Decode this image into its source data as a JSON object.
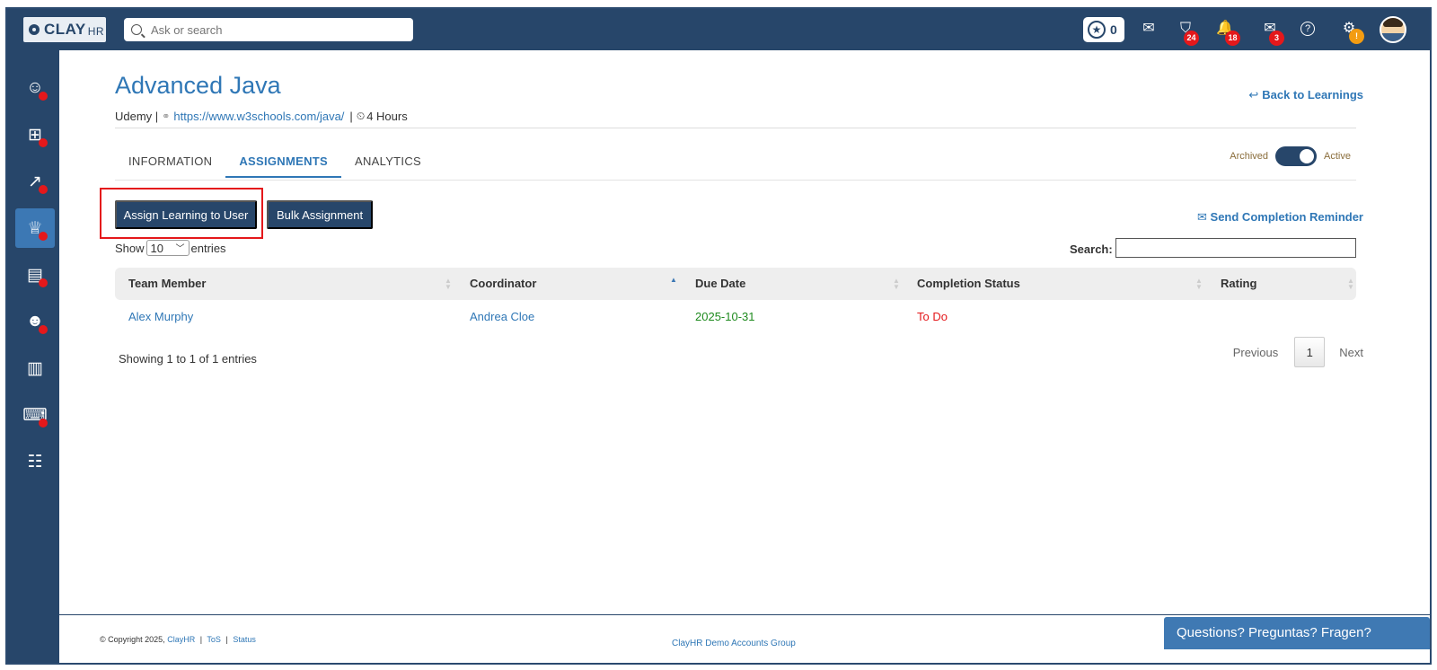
{
  "header": {
    "logo_text": "CLAY",
    "logo_suffix": "HR",
    "search_placeholder": "Ask or search",
    "star_count": "0",
    "icons": [
      {
        "name": "message-icon",
        "glyph": "✉"
      },
      {
        "name": "learning-icon",
        "glyph": "⛉",
        "badge": "24"
      },
      {
        "name": "bell-icon",
        "glyph": "🔔",
        "badge": "18"
      },
      {
        "name": "mail-icon",
        "glyph": "✉",
        "badge": "3"
      },
      {
        "name": "help-icon",
        "glyph": "?"
      },
      {
        "name": "settings-icon",
        "glyph": "⚙",
        "badge": "!"
      }
    ]
  },
  "sidebar": {
    "items": [
      {
        "name": "sidebar-item-people",
        "icon": "people-icon",
        "glyph": "☺"
      },
      {
        "name": "sidebar-item-payroll",
        "icon": "payroll-icon",
        "glyph": "⊞"
      },
      {
        "name": "sidebar-item-performance",
        "icon": "chart-up-icon",
        "glyph": "↗"
      },
      {
        "name": "sidebar-item-learning",
        "icon": "learning-icon",
        "glyph": "♕",
        "active": true
      },
      {
        "name": "sidebar-item-documents",
        "icon": "document-icon",
        "glyph": "▤"
      },
      {
        "name": "sidebar-item-recruiting",
        "icon": "user-circle-icon",
        "glyph": "☻"
      },
      {
        "name": "sidebar-item-reports",
        "icon": "report-icon",
        "glyph": "▥"
      },
      {
        "name": "sidebar-item-onboarding",
        "icon": "onboarding-icon",
        "glyph": "⌨"
      },
      {
        "name": "sidebar-item-tasks",
        "icon": "clipboard-icon",
        "glyph": "☷"
      }
    ]
  },
  "page": {
    "title": "Advanced Java",
    "provider": "Udemy |",
    "url": "https://www.w3schools.com/java/",
    "sep": "|",
    "duration": "4 Hours",
    "back_label": "Back to Learnings",
    "tabs": [
      "INFORMATION",
      "ASSIGNMENTS",
      "ANALYTICS"
    ],
    "toggle_left": "Archived",
    "toggle_right": "Active",
    "assign_button": "Assign Learning to User",
    "bulk_button": "Bulk Assignment",
    "reminder": "Send Completion Reminder",
    "show_label": "Show",
    "entries_value": "10",
    "entries_label": "entries",
    "search_label": "Search:"
  },
  "table": {
    "headers": [
      "Team Member",
      "Coordinator",
      "Due Date",
      "Completion Status",
      "Rating"
    ],
    "rows": [
      {
        "member": "Alex Murphy",
        "coordinator": "Andrea Cloe",
        "due": "2025-10-31",
        "status": "To Do",
        "rating": ""
      }
    ],
    "info": "Showing 1 to 1 of 1 entries",
    "prev": "Previous",
    "page": "1",
    "next": "Next"
  },
  "footer": {
    "copyright": "© Copyright 2025,",
    "brand": "ClayHR",
    "tos": "ToS",
    "status": "Status",
    "sep": "|",
    "group": "ClayHR Demo Accounts Group",
    "help": "Questions? Preguntas? Fragen?"
  },
  "colors": {
    "navy": "#27466a",
    "link": "#2f77b6",
    "badge": "#e4181b",
    "due": "#1e8a1e"
  }
}
